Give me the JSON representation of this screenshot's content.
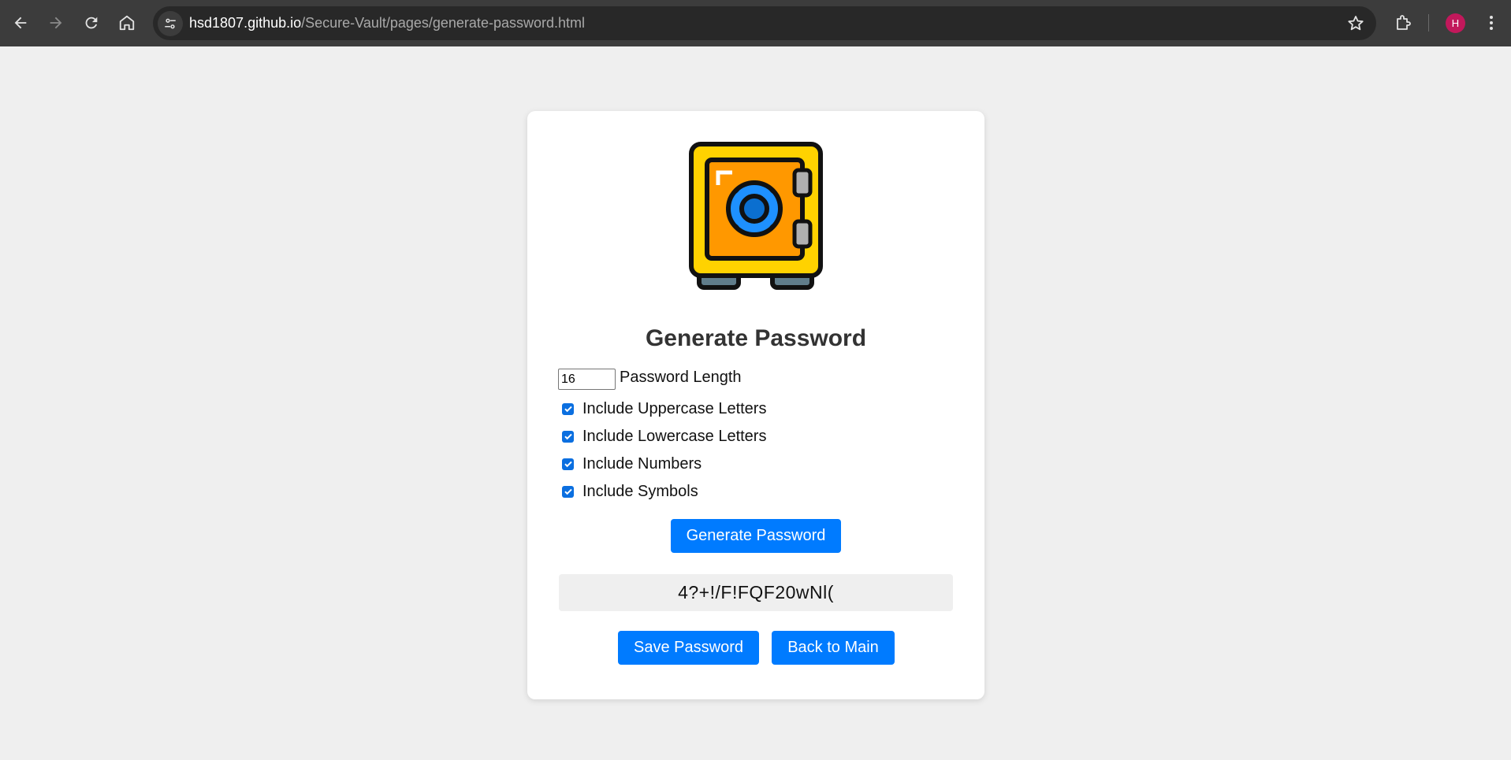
{
  "browser": {
    "url_host": "hsd1807.github.io",
    "url_path": "/Secure-Vault/pages/generate-password.html",
    "profile_initial": "H"
  },
  "page": {
    "title": "Generate Password",
    "length_value": "16",
    "length_label": "Password Length",
    "options": [
      {
        "label": "Include Uppercase Letters",
        "checked": true
      },
      {
        "label": "Include Lowercase Letters",
        "checked": true
      },
      {
        "label": "Include Numbers",
        "checked": true
      },
      {
        "label": "Include Symbols",
        "checked": true
      }
    ],
    "generate_button": "Generate Password",
    "generated_password": "4?+!/F!FQF20wNl(",
    "save_button": "Save Password",
    "back_button": "Back to Main"
  },
  "colors": {
    "accent": "#007bff",
    "page_bg": "#efefef",
    "chrome_bg": "#3c3c3c"
  }
}
